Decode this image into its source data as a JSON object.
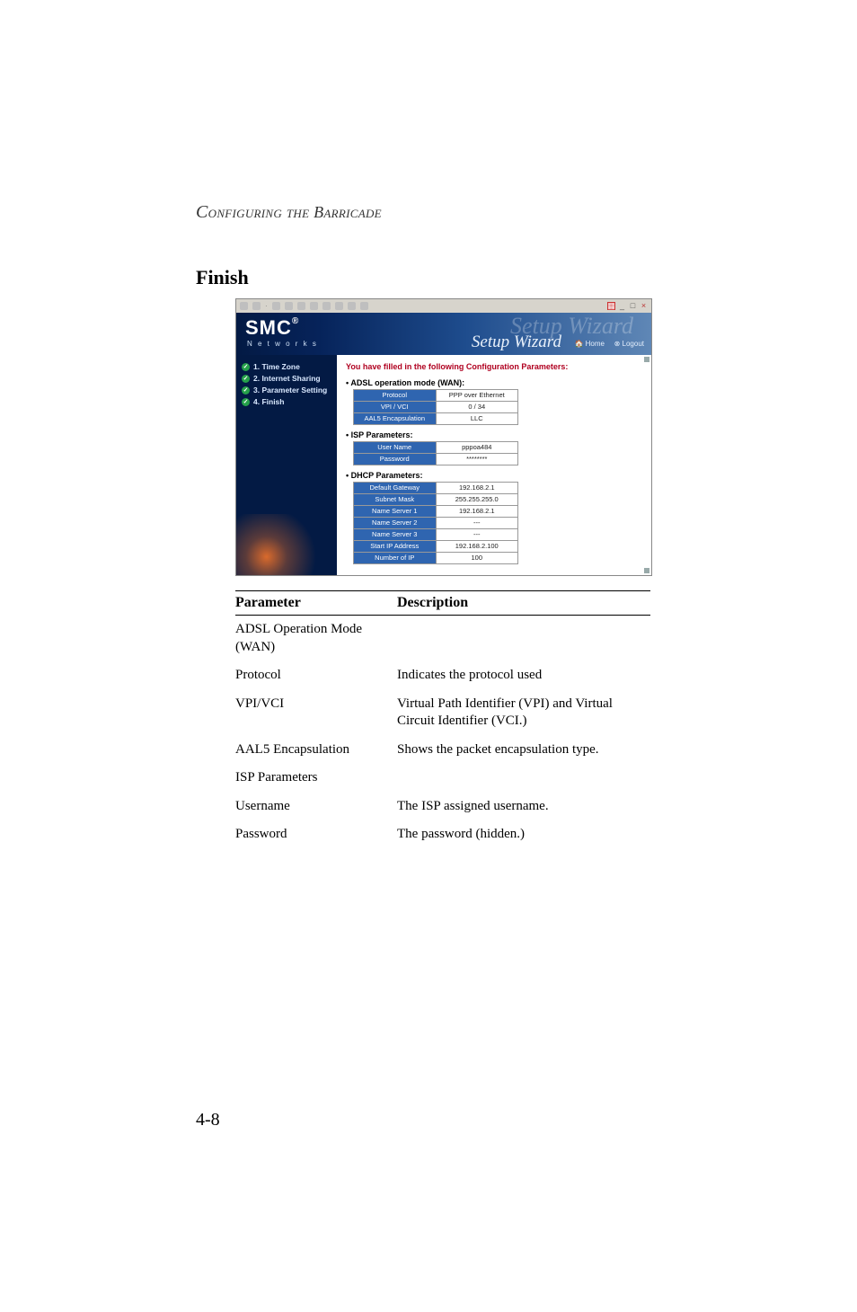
{
  "running_head": "Configuring the Barricade",
  "section_title": "Finish",
  "page_number": "4-8",
  "screenshot": {
    "banner": {
      "brand": "SMC",
      "brand_reg": "®",
      "brand_sub": "N e t w o r k s",
      "title_ghost": "Setup Wizard",
      "title_main": "Setup Wizard",
      "home": "Home",
      "logout": "Logout"
    },
    "nav": {
      "items": [
        "1. Time Zone",
        "2. Internet Sharing",
        "3. Parameter Setting",
        "4. Finish"
      ]
    },
    "message": "You have filled in the following Configuration Parameters:",
    "groups": [
      {
        "title": "ADSL operation mode (WAN):",
        "rows": [
          {
            "k": "Protocol",
            "v": "PPP over Ethernet"
          },
          {
            "k": "VPI / VCI",
            "v": "0 / 34"
          },
          {
            "k": "AAL5 Encapsulation",
            "v": "LLC"
          }
        ]
      },
      {
        "title": "ISP Parameters:",
        "rows": [
          {
            "k": "User Name",
            "v": "pppoa484"
          },
          {
            "k": "Password",
            "v": "********"
          }
        ]
      },
      {
        "title": "DHCP Parameters:",
        "rows": [
          {
            "k": "Default Gateway",
            "v": "192.168.2.1"
          },
          {
            "k": "Subnet Mask",
            "v": "255.255.255.0"
          },
          {
            "k": "Name Server 1",
            "v": "192.168.2.1"
          },
          {
            "k": "Name Server 2",
            "v": "---"
          },
          {
            "k": "Name Server 3",
            "v": "---"
          },
          {
            "k": "Start IP Address",
            "v": "192.168.2.100"
          },
          {
            "k": "Number of IP",
            "v": "100"
          }
        ]
      }
    ]
  },
  "table": {
    "headers": {
      "param": "Parameter",
      "desc": "Description"
    },
    "rows": [
      {
        "param": "ADSL Operation Mode (WAN)",
        "desc": "",
        "cls": ""
      },
      {
        "param": "Protocol",
        "desc": "Indicates the protocol used",
        "cls": "pad1"
      },
      {
        "param": "VPI/VCI",
        "desc": "Virtual Path Identifier (VPI) and Virtual Circuit Identifier (VCI.)",
        "cls": "pad1"
      },
      {
        "param": "AAL5 Encapsulation",
        "desc": "Shows the packet encapsulation type.",
        "cls": "pad1"
      },
      {
        "param": "ISP Parameters",
        "desc": "",
        "cls": "grouprow"
      },
      {
        "param": "Username",
        "desc": "The ISP assigned username.",
        "cls": "pad1"
      },
      {
        "param": "Password",
        "desc": "The password (hidden.)",
        "cls": "pad1"
      }
    ]
  }
}
